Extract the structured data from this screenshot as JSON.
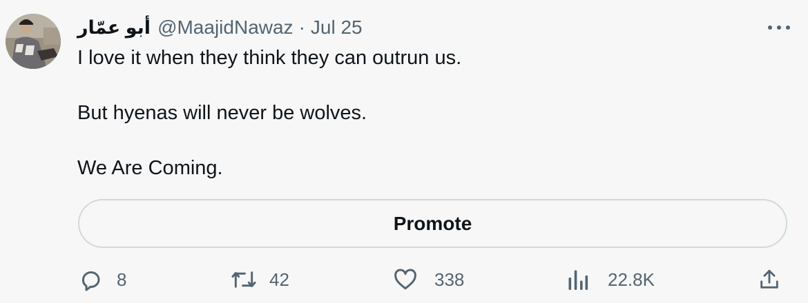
{
  "tweet": {
    "author": {
      "display_name": "أبو عمّار",
      "handle": "@MaajidNawaz",
      "avatar_icon": "profile-photo"
    },
    "separator": "·",
    "date": "Jul 25",
    "more_icon": "ellipsis-icon",
    "lines": [
      "I love it when they think they can outrun us.",
      "But hyenas will never be wolves.",
      "We Are Coming."
    ],
    "promote_label": "Promote",
    "actions": {
      "replies": {
        "icon": "reply-icon",
        "count": "8"
      },
      "retweets": {
        "icon": "retweet-icon",
        "count": "42"
      },
      "likes": {
        "icon": "heart-icon",
        "count": "338"
      },
      "views": {
        "icon": "analytics-icon",
        "count": "22.8K"
      },
      "share": {
        "icon": "share-icon"
      }
    }
  },
  "colors": {
    "background": "#f7f7f7",
    "text_primary": "#0f1419",
    "text_secondary": "#536471",
    "border": "#cfd9de"
  }
}
